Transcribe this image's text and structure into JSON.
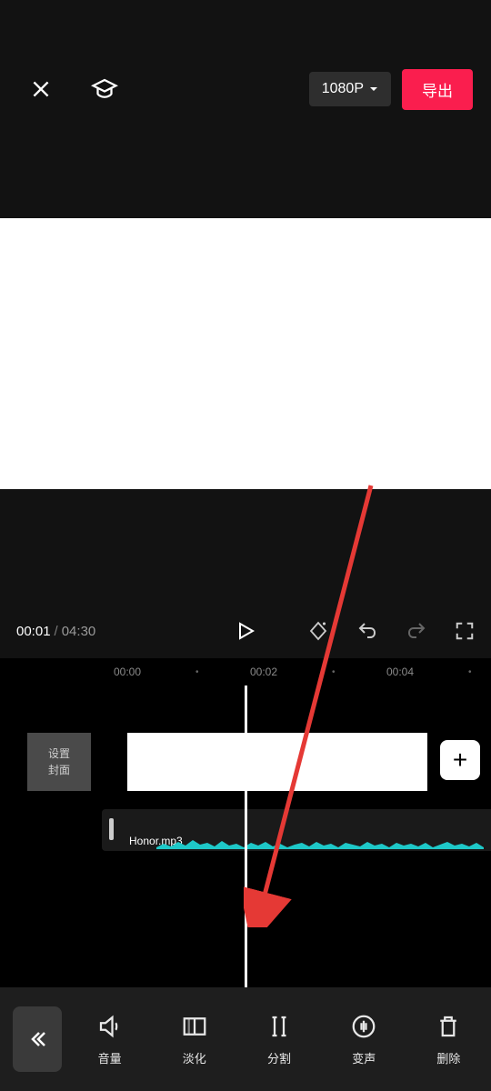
{
  "header": {
    "resolution": "1080P",
    "export": "导出"
  },
  "playback": {
    "current": "00:01",
    "separator": "/",
    "duration": "04:30"
  },
  "ruler": {
    "t0": "00:00",
    "t1": "00:02",
    "t2": "00:04"
  },
  "timeline": {
    "cover_line1": "设置",
    "cover_line2": "封面",
    "audio_file": "Honor.mp3",
    "add": "+"
  },
  "toolbar": {
    "volume": "音量",
    "fade": "淡化",
    "split": "分割",
    "voicechange": "变声",
    "delete": "删除"
  }
}
